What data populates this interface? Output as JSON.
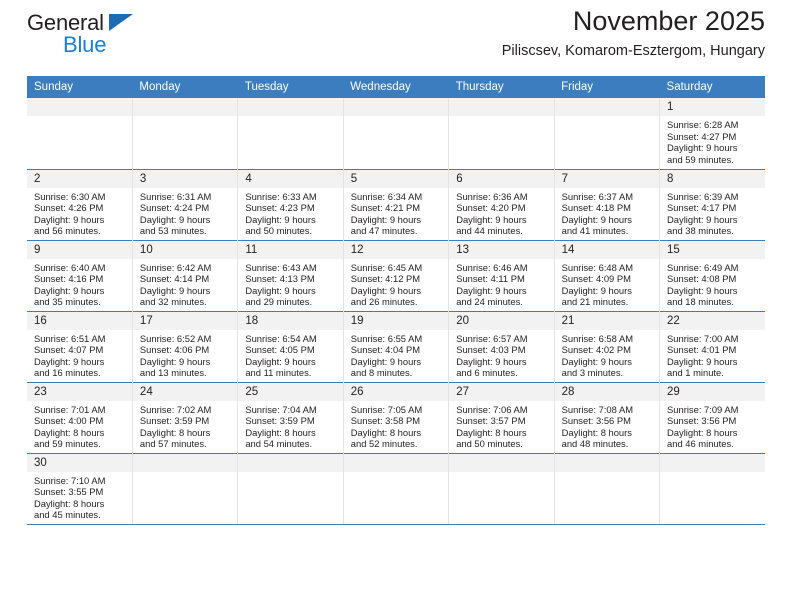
{
  "logo": {
    "word_one": "General",
    "word_two": "Blue",
    "triangle_color": "#1c6cb5",
    "blue_text_color": "#1c7fd0"
  },
  "header": {
    "title": "November 2025",
    "location": "Piliscsev, Komarom-Esztergom, Hungary"
  },
  "theme": {
    "header_blue": "#3b7dbf",
    "daynum_band": "#f2f2f2",
    "text": "#231f20",
    "cell_divider": "#e3e3e3"
  },
  "calendar": {
    "weekday_headers": [
      "Sunday",
      "Monday",
      "Tuesday",
      "Wednesday",
      "Thursday",
      "Friday",
      "Saturday"
    ],
    "weeks": [
      [
        {
          "day": "",
          "empty": true,
          "lines": []
        },
        {
          "day": "",
          "empty": true,
          "lines": []
        },
        {
          "day": "",
          "empty": true,
          "lines": []
        },
        {
          "day": "",
          "empty": true,
          "lines": []
        },
        {
          "day": "",
          "empty": true,
          "lines": []
        },
        {
          "day": "",
          "empty": true,
          "lines": []
        },
        {
          "day": "1",
          "empty": false,
          "lines": [
            "Sunrise: 6:28 AM",
            "Sunset: 4:27 PM",
            "Daylight: 9 hours",
            "and 59 minutes."
          ]
        }
      ],
      [
        {
          "day": "2",
          "empty": false,
          "lines": [
            "Sunrise: 6:30 AM",
            "Sunset: 4:26 PM",
            "Daylight: 9 hours",
            "and 56 minutes."
          ]
        },
        {
          "day": "3",
          "empty": false,
          "lines": [
            "Sunrise: 6:31 AM",
            "Sunset: 4:24 PM",
            "Daylight: 9 hours",
            "and 53 minutes."
          ]
        },
        {
          "day": "4",
          "empty": false,
          "lines": [
            "Sunrise: 6:33 AM",
            "Sunset: 4:23 PM",
            "Daylight: 9 hours",
            "and 50 minutes."
          ]
        },
        {
          "day": "5",
          "empty": false,
          "lines": [
            "Sunrise: 6:34 AM",
            "Sunset: 4:21 PM",
            "Daylight: 9 hours",
            "and 47 minutes."
          ]
        },
        {
          "day": "6",
          "empty": false,
          "lines": [
            "Sunrise: 6:36 AM",
            "Sunset: 4:20 PM",
            "Daylight: 9 hours",
            "and 44 minutes."
          ]
        },
        {
          "day": "7",
          "empty": false,
          "lines": [
            "Sunrise: 6:37 AM",
            "Sunset: 4:18 PM",
            "Daylight: 9 hours",
            "and 41 minutes."
          ]
        },
        {
          "day": "8",
          "empty": false,
          "lines": [
            "Sunrise: 6:39 AM",
            "Sunset: 4:17 PM",
            "Daylight: 9 hours",
            "and 38 minutes."
          ]
        }
      ],
      [
        {
          "day": "9",
          "empty": false,
          "lines": [
            "Sunrise: 6:40 AM",
            "Sunset: 4:16 PM",
            "Daylight: 9 hours",
            "and 35 minutes."
          ]
        },
        {
          "day": "10",
          "empty": false,
          "lines": [
            "Sunrise: 6:42 AM",
            "Sunset: 4:14 PM",
            "Daylight: 9 hours",
            "and 32 minutes."
          ]
        },
        {
          "day": "11",
          "empty": false,
          "lines": [
            "Sunrise: 6:43 AM",
            "Sunset: 4:13 PM",
            "Daylight: 9 hours",
            "and 29 minutes."
          ]
        },
        {
          "day": "12",
          "empty": false,
          "lines": [
            "Sunrise: 6:45 AM",
            "Sunset: 4:12 PM",
            "Daylight: 9 hours",
            "and 26 minutes."
          ]
        },
        {
          "day": "13",
          "empty": false,
          "lines": [
            "Sunrise: 6:46 AM",
            "Sunset: 4:11 PM",
            "Daylight: 9 hours",
            "and 24 minutes."
          ]
        },
        {
          "day": "14",
          "empty": false,
          "lines": [
            "Sunrise: 6:48 AM",
            "Sunset: 4:09 PM",
            "Daylight: 9 hours",
            "and 21 minutes."
          ]
        },
        {
          "day": "15",
          "empty": false,
          "lines": [
            "Sunrise: 6:49 AM",
            "Sunset: 4:08 PM",
            "Daylight: 9 hours",
            "and 18 minutes."
          ]
        }
      ],
      [
        {
          "day": "16",
          "empty": false,
          "lines": [
            "Sunrise: 6:51 AM",
            "Sunset: 4:07 PM",
            "Daylight: 9 hours",
            "and 16 minutes."
          ]
        },
        {
          "day": "17",
          "empty": false,
          "lines": [
            "Sunrise: 6:52 AM",
            "Sunset: 4:06 PM",
            "Daylight: 9 hours",
            "and 13 minutes."
          ]
        },
        {
          "day": "18",
          "empty": false,
          "lines": [
            "Sunrise: 6:54 AM",
            "Sunset: 4:05 PM",
            "Daylight: 9 hours",
            "and 11 minutes."
          ]
        },
        {
          "day": "19",
          "empty": false,
          "lines": [
            "Sunrise: 6:55 AM",
            "Sunset: 4:04 PM",
            "Daylight: 9 hours",
            "and 8 minutes."
          ]
        },
        {
          "day": "20",
          "empty": false,
          "lines": [
            "Sunrise: 6:57 AM",
            "Sunset: 4:03 PM",
            "Daylight: 9 hours",
            "and 6 minutes."
          ]
        },
        {
          "day": "21",
          "empty": false,
          "lines": [
            "Sunrise: 6:58 AM",
            "Sunset: 4:02 PM",
            "Daylight: 9 hours",
            "and 3 minutes."
          ]
        },
        {
          "day": "22",
          "empty": false,
          "lines": [
            "Sunrise: 7:00 AM",
            "Sunset: 4:01 PM",
            "Daylight: 9 hours",
            "and 1 minute."
          ]
        }
      ],
      [
        {
          "day": "23",
          "empty": false,
          "lines": [
            "Sunrise: 7:01 AM",
            "Sunset: 4:00 PM",
            "Daylight: 8 hours",
            "and 59 minutes."
          ]
        },
        {
          "day": "24",
          "empty": false,
          "lines": [
            "Sunrise: 7:02 AM",
            "Sunset: 3:59 PM",
            "Daylight: 8 hours",
            "and 57 minutes."
          ]
        },
        {
          "day": "25",
          "empty": false,
          "lines": [
            "Sunrise: 7:04 AM",
            "Sunset: 3:59 PM",
            "Daylight: 8 hours",
            "and 54 minutes."
          ]
        },
        {
          "day": "26",
          "empty": false,
          "lines": [
            "Sunrise: 7:05 AM",
            "Sunset: 3:58 PM",
            "Daylight: 8 hours",
            "and 52 minutes."
          ]
        },
        {
          "day": "27",
          "empty": false,
          "lines": [
            "Sunrise: 7:06 AM",
            "Sunset: 3:57 PM",
            "Daylight: 8 hours",
            "and 50 minutes."
          ]
        },
        {
          "day": "28",
          "empty": false,
          "lines": [
            "Sunrise: 7:08 AM",
            "Sunset: 3:56 PM",
            "Daylight: 8 hours",
            "and 48 minutes."
          ]
        },
        {
          "day": "29",
          "empty": false,
          "lines": [
            "Sunrise: 7:09 AM",
            "Sunset: 3:56 PM",
            "Daylight: 8 hours",
            "and 46 minutes."
          ]
        }
      ],
      [
        {
          "day": "30",
          "empty": false,
          "lines": [
            "Sunrise: 7:10 AM",
            "Sunset: 3:55 PM",
            "Daylight: 8 hours",
            "and 45 minutes."
          ]
        },
        {
          "day": "",
          "empty": true,
          "lines": []
        },
        {
          "day": "",
          "empty": true,
          "lines": []
        },
        {
          "day": "",
          "empty": true,
          "lines": []
        },
        {
          "day": "",
          "empty": true,
          "lines": []
        },
        {
          "day": "",
          "empty": true,
          "lines": []
        },
        {
          "day": "",
          "empty": true,
          "lines": []
        }
      ]
    ]
  }
}
